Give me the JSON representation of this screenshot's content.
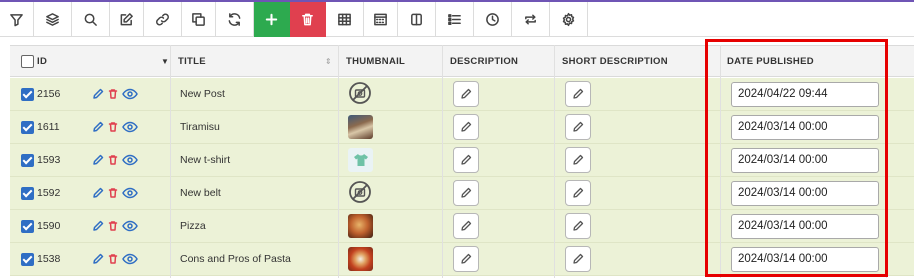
{
  "toolbar": {
    "buttons": [
      {
        "icon": "filter-icon"
      },
      {
        "icon": "layers-icon"
      },
      {
        "icon": "search-icon"
      },
      {
        "icon": "edit-icon"
      },
      {
        "icon": "link-icon"
      },
      {
        "icon": "duplicate-icon"
      },
      {
        "icon": "refresh-icon"
      },
      {
        "icon": "add-icon",
        "color": "#2daa4f"
      },
      {
        "icon": "trash-icon",
        "color": "#e0404f"
      },
      {
        "icon": "table-icon"
      },
      {
        "icon": "dotted-table-icon"
      },
      {
        "icon": "columns-icon"
      },
      {
        "icon": "list-icon"
      },
      {
        "icon": "clock-icon"
      },
      {
        "icon": "repeat-icon"
      },
      {
        "icon": "gear-icon"
      }
    ]
  },
  "grid": {
    "columns": {
      "id": "ID",
      "title": "TITLE",
      "thumbnail": "THUMBNAIL",
      "description": "DESCRIPTION",
      "short_description": "SHORT DESCRIPTION",
      "date_published": "DATE PUBLISHED"
    },
    "rows": [
      {
        "id": "2156",
        "title": "New Post",
        "thumbnail": "no-image-icon",
        "date": "2024/04/22 09:44"
      },
      {
        "id": "1611",
        "title": "Tiramisu",
        "thumbnail": "tiramisu-thumbnail",
        "date": "2024/03/14 00:00"
      },
      {
        "id": "1593",
        "title": "New t-shirt",
        "thumbnail": "tshirt-thumbnail",
        "date": "2024/03/14 00:00"
      },
      {
        "id": "1592",
        "title": "New belt",
        "thumbnail": "no-image-icon",
        "date": "2024/03/14 00:00"
      },
      {
        "id": "1590",
        "title": "Pizza",
        "thumbnail": "pizza-thumbnail",
        "date": "2024/03/14 00:00"
      },
      {
        "id": "1538",
        "title": "Cons and Pros of Pasta",
        "thumbnail": "pasta-thumbnail",
        "date": "2024/03/14 00:00"
      }
    ]
  },
  "colors": {
    "accent_line": "#6f55b5",
    "row_background": "#ecf2d7",
    "highlight_border": "#e60000",
    "checkbox": "#2f6ec4",
    "edit_action": "#2f6ec4",
    "delete_action": "#e0404f",
    "view_action": "#2f6ec4"
  }
}
